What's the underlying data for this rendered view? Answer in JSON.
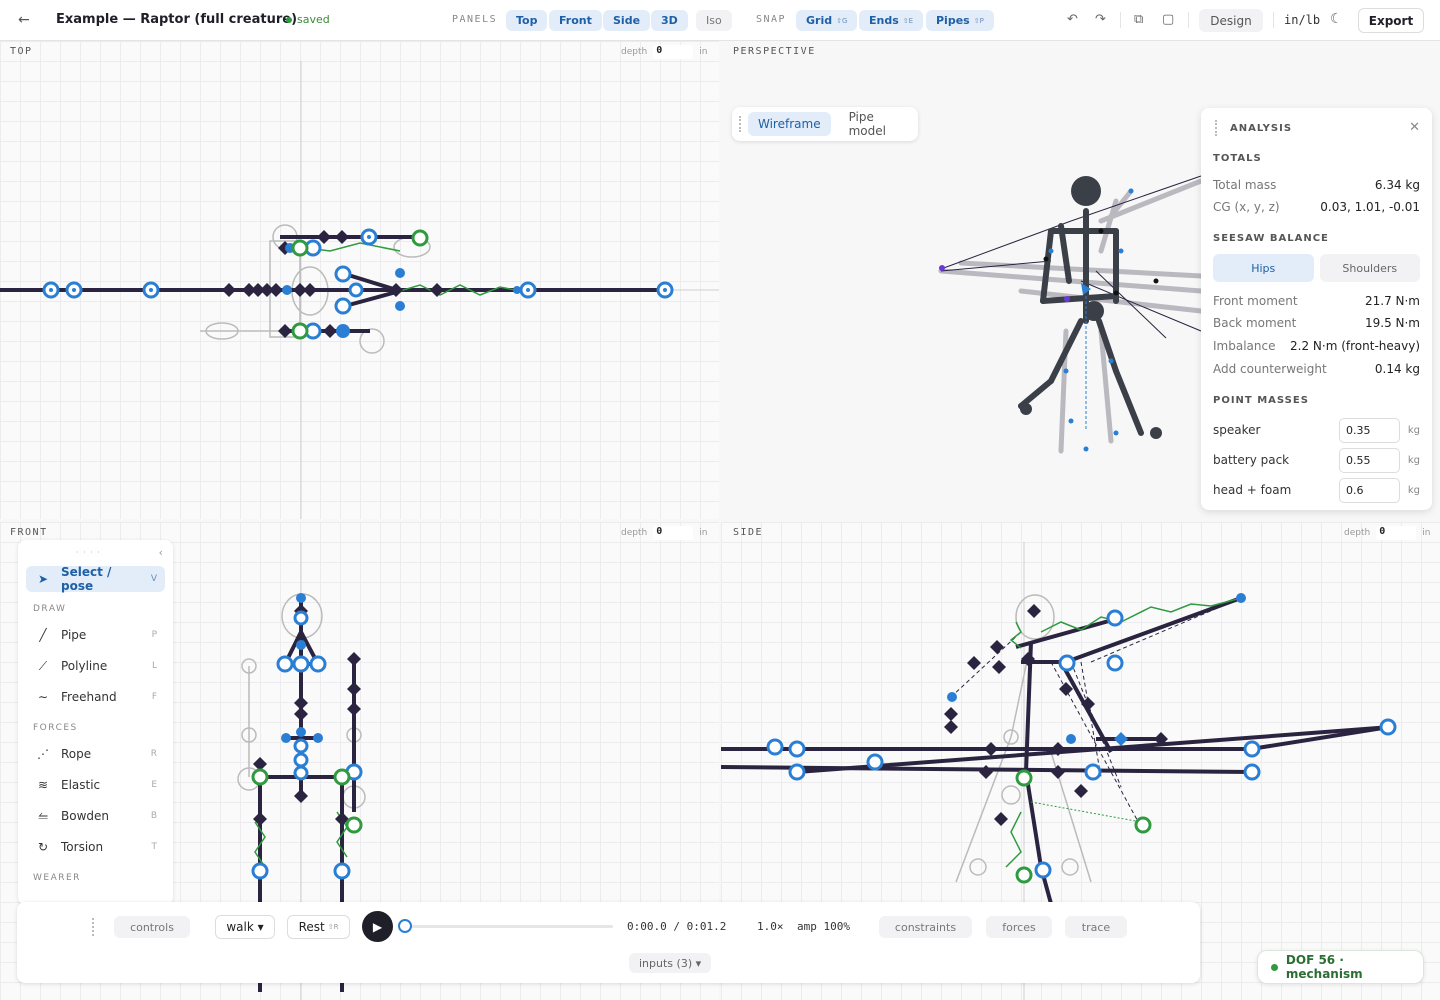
{
  "header": {
    "back_glyph": "←",
    "title": "Example — Raptor (full creature)",
    "status": "saved",
    "panels_label": "PANELS",
    "panels": [
      {
        "label": "Top",
        "active": true
      },
      {
        "label": "Front",
        "active": true
      },
      {
        "label": "Side",
        "active": true
      },
      {
        "label": "3D",
        "active": true
      },
      {
        "label": "Iso",
        "active": false
      }
    ],
    "snap_label": "SNAP",
    "snap": [
      {
        "label": "Grid",
        "key": "⇧G"
      },
      {
        "label": "Ends",
        "key": "⇧E"
      },
      {
        "label": "Pipes",
        "key": "⇧P"
      }
    ],
    "design_label": "Design",
    "units_label": "in/lb",
    "export_label": "Export"
  },
  "panes": {
    "top": {
      "title": "TOP",
      "depth_label": "depth",
      "depth_value": "0",
      "unit": "in"
    },
    "perspective": {
      "title": "PERSPECTIVE"
    },
    "front": {
      "title": "FRONT",
      "depth_label": "depth",
      "depth_value": "0",
      "unit": "in"
    },
    "side": {
      "title": "SIDE",
      "depth_label": "depth",
      "depth_value": "0",
      "unit": "in"
    }
  },
  "view_mode": {
    "options": [
      "Wireframe",
      "Pipe model"
    ],
    "selected": "Wireframe"
  },
  "analysis": {
    "title": "ANALYSIS",
    "totals_label": "TOTALS",
    "total_mass_label": "Total mass",
    "total_mass": "6.34 kg",
    "cg_label": "CG (x, y, z)",
    "cg": "0.03, 1.01, -0.01",
    "seesaw_label": "SEESAW BALANCE",
    "seesaw_tabs": [
      "Hips",
      "Shoulders"
    ],
    "front_moment_label": "Front moment",
    "front_moment": "21.7 N·m",
    "back_moment_label": "Back moment",
    "back_moment": "19.5 N·m",
    "imbalance_label": "Imbalance",
    "imbalance": "2.2 N·m (front-heavy)",
    "counterweight_label": "Add counterweight",
    "counterweight": "0.14 kg",
    "point_masses_label": "POINT MASSES",
    "point_masses": [
      {
        "name": "speaker",
        "value": "0.35",
        "unit": "kg"
      },
      {
        "name": "battery pack",
        "value": "0.55",
        "unit": "kg"
      },
      {
        "name": "head + foam",
        "value": "0.6",
        "unit": "kg"
      }
    ]
  },
  "tools": {
    "select": {
      "label": "Select / pose",
      "key": "V"
    },
    "draw_label": "DRAW",
    "draw": [
      {
        "label": "Pipe",
        "key": "P",
        "icon": "pipe-icon"
      },
      {
        "label": "Polyline",
        "key": "L",
        "icon": "polyline-icon"
      },
      {
        "label": "Freehand",
        "key": "F",
        "icon": "freehand-icon"
      }
    ],
    "forces_label": "FORCES",
    "forces": [
      {
        "label": "Rope",
        "key": "R",
        "icon": "rope-icon"
      },
      {
        "label": "Elastic",
        "key": "E",
        "icon": "elastic-icon"
      },
      {
        "label": "Bowden",
        "key": "B",
        "icon": "bowden-icon"
      },
      {
        "label": "Torsion",
        "key": "T",
        "icon": "torsion-icon"
      }
    ],
    "wearer_label": "WEARER"
  },
  "playbar": {
    "controls_label": "controls",
    "gait": "walk ▾",
    "rest_label": "Rest",
    "rest_key": "⇧R",
    "time": "0:00.0 / 0:01.2",
    "progress": 0,
    "speed": "1.0×",
    "amp": "amp 100%",
    "constraints_label": "constraints",
    "forces_label": "forces",
    "trace_label": "trace",
    "inputs_label": "inputs (3) ▾"
  },
  "status": {
    "dof": "DOF 56 · mechanism"
  },
  "colors": {
    "accent": "#1e5fa6",
    "accent_bg": "#e2edf9",
    "rod": "#2a2440",
    "joint": "#2a7fd4",
    "spring": "#2f9a3f",
    "ok": "#2a6e34"
  }
}
